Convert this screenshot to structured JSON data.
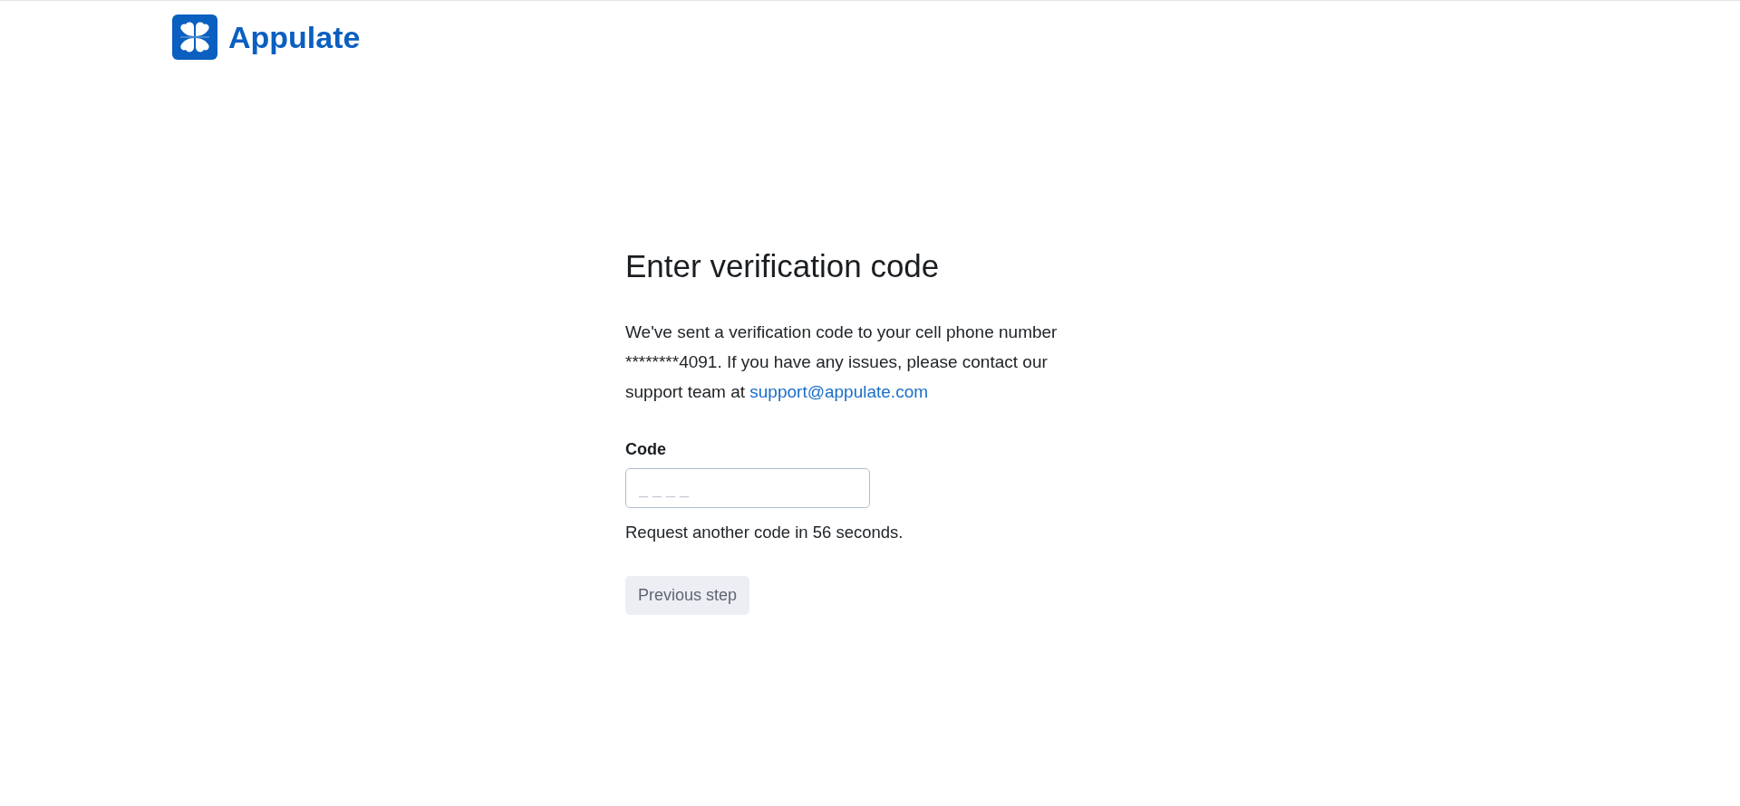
{
  "header": {
    "brand": "Appulate"
  },
  "heading": "Enter verification code",
  "message": {
    "text": "We've sent a verification code to your cell phone number ********4091. If you have any issues, please contact our support team at ",
    "link": "support@appulate.com"
  },
  "code_field": {
    "label": "Code",
    "placeholder": "_ _ _ _"
  },
  "resend_note": "Request another code in 56 seconds.",
  "buttons": [
    {
      "label": "Previous step",
      "disabled": true
    }
  ]
}
